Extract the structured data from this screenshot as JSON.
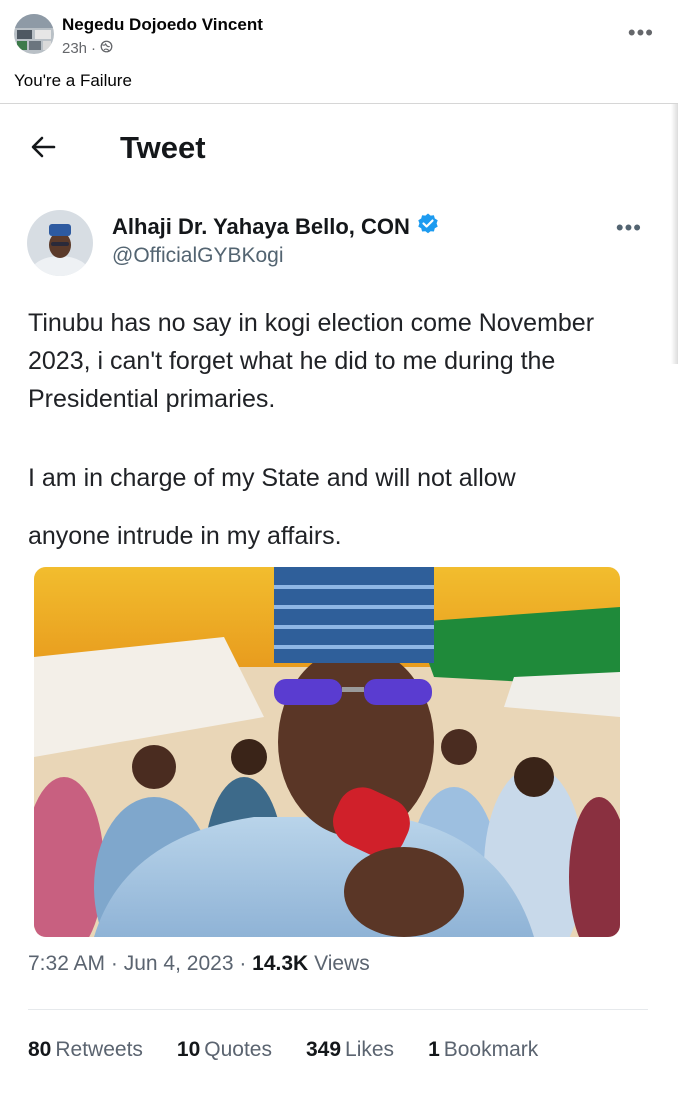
{
  "post": {
    "author": "Negedu Dojoedo Vincent",
    "time": "23h",
    "caption": "You're a Failure",
    "icons": {
      "more": "more-horizontal-icon",
      "audience": "globe-icon"
    }
  },
  "tweet": {
    "header_title": "Tweet",
    "author_name": "Alhaji Dr. Yahaya Bello, CON",
    "handle": "@OfficialGYBKogi",
    "text_p1": "Tinubu has no say in kogi election come November 2023, i can't forget what he did to me during the Presidential primaries.",
    "text_p2_line1": "I am in charge of my State and will not allow",
    "text_p2_line2": "anyone intrude in my affairs.",
    "time": "7:32 AM",
    "date": "Jun 4, 2023",
    "views_count": "14.3K",
    "views_label": "Views",
    "stats": [
      {
        "count": "80",
        "label": "Retweets"
      },
      {
        "count": "10",
        "label": "Quotes"
      },
      {
        "count": "349",
        "label": "Likes"
      },
      {
        "count": "1",
        "label": "Bookmark"
      }
    ],
    "colors": {
      "verified": "#1d9bf0",
      "text": "#202226",
      "muted": "#5b6470"
    }
  }
}
